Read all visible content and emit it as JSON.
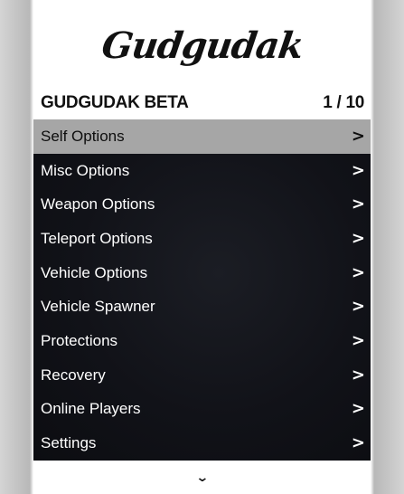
{
  "header": {
    "logo_text": "Gudgudak"
  },
  "subheader": {
    "title": "GUDGUDAK BETA",
    "counter": "1 / 10"
  },
  "menu": {
    "items": [
      {
        "label": "Self Options",
        "arrow": ">"
      },
      {
        "label": "Misc Options",
        "arrow": ">"
      },
      {
        "label": "Weapon Options",
        "arrow": ">"
      },
      {
        "label": "Teleport Options",
        "arrow": ">"
      },
      {
        "label": "Vehicle Options",
        "arrow": ">"
      },
      {
        "label": "Vehicle Spawner",
        "arrow": ">"
      },
      {
        "label": "Protections",
        "arrow": ">"
      },
      {
        "label": "Recovery",
        "arrow": ">"
      },
      {
        "label": "Online Players",
        "arrow": ">"
      },
      {
        "label": "Settings",
        "arrow": ">"
      }
    ],
    "selected_index": 0
  },
  "footer": {
    "arrow_icon": "chevron-down-icon",
    "arrow_glyph": "⌄"
  },
  "colors": {
    "selected_bg": "#a6a6a6",
    "items_bg": "#111218",
    "header_bg": "#ffffff"
  }
}
